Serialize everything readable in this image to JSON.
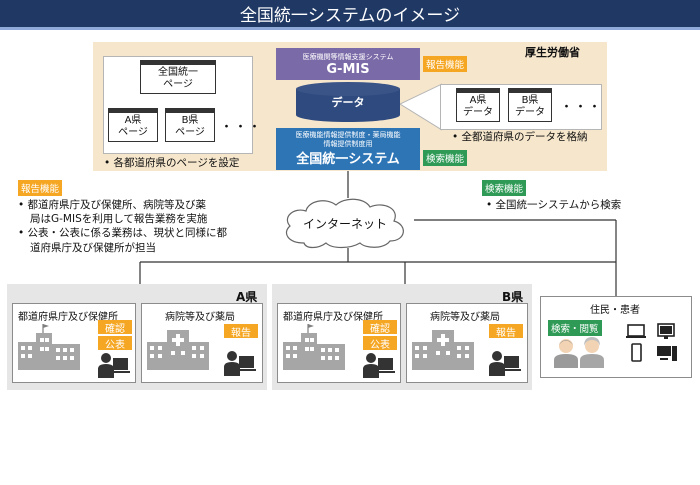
{
  "title": "全国統一システムのイメージ",
  "mhlw": {
    "label": "厚生労働省",
    "gmis_subtitle": "医療機関等情報支援システム",
    "gmis_name": "G-MIS",
    "db_label": "データ",
    "system_subtitle_1": "医療機能情報提供制度・薬局機能",
    "system_subtitle_2": "情報提供制度用",
    "system_name": "全国統一システム",
    "report_tag": "報告機能",
    "search_tag": "検索機能",
    "pages": {
      "national_1": "全国統一",
      "national_2": "ページ",
      "a_1": "A県",
      "a_2": "ページ",
      "b_1": "B県",
      "b_2": "ページ",
      "dots": "・・・"
    },
    "pages_note": "各都道府県のページを設定",
    "data_boxes": {
      "a_1": "A県",
      "a_2": "データ",
      "b_1": "B県",
      "b_2": "データ",
      "dots": "・・・"
    },
    "data_note": "全都道府県のデータを格納"
  },
  "left_notes": {
    "tag": "報告機能",
    "b1_l1": "都道府県庁及び保健所、病院等及び薬",
    "b1_l2": "局はG-MISを利用して報告業務を実施",
    "b2_l1": "公表・公表に係る業務は、現状と同様に都",
    "b2_l2": "道府県庁及び保健所が担当"
  },
  "right_notes": {
    "tag": "検索機能",
    "b1": "全国統一システムから検索"
  },
  "internet": "インターネット",
  "prefectures": [
    {
      "label": "A県",
      "office_title": "都道府県庁及び保健所",
      "confirm_tag": "確認",
      "publish_tag": "公表",
      "hospital_title": "病院等及び薬局",
      "report_tag": "報告"
    },
    {
      "label": "B県",
      "office_title": "都道府県庁及び保健所",
      "confirm_tag": "確認",
      "publish_tag": "公表",
      "hospital_title": "病院等及び薬局",
      "report_tag": "報告"
    }
  ],
  "resident": {
    "title": "住民・患者",
    "tag": "検索・閲覧"
  },
  "colors": {
    "title_bar": "#1f3864",
    "mhlw_bg": "#f5e6cc",
    "gmis": "#7b6aa8",
    "system": "#2e75b6",
    "report_tag": "#f5a623",
    "search_tag": "#2e9a56",
    "prefecture_bg": "#e7e6e6"
  }
}
